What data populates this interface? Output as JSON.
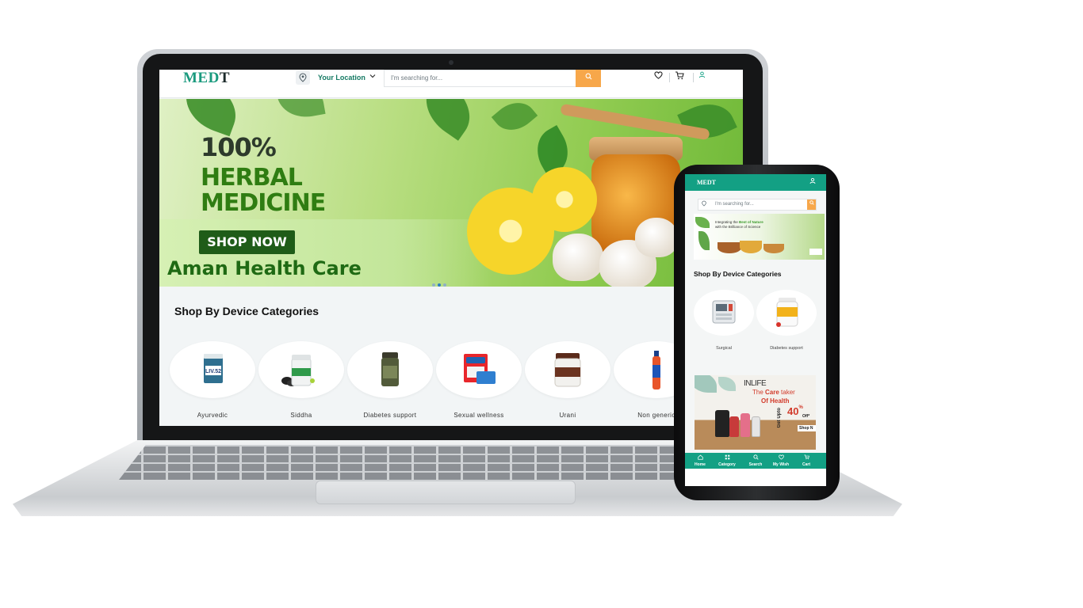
{
  "desktop": {
    "logo": {
      "main": "MED",
      "accent": "T"
    },
    "location": {
      "label": "Your Location",
      "pin_icon": "map-pin-icon",
      "chevron_icon": "chevron-down-icon"
    },
    "search": {
      "placeholder": "I'm searching for...",
      "button_icon": "search-icon"
    },
    "nav_icons": [
      "heart-icon",
      "cart-icon",
      "user-icon"
    ],
    "hero": {
      "line1": "100%",
      "line2": "HERBAL",
      "line3": "MEDICINE",
      "button": "SHOP NOW",
      "brand": "Aman Health Care",
      "slides": 3,
      "active_slide": 2
    },
    "categories_title": "Shop By Device Categories",
    "categories": [
      {
        "label": "Ayurvedic"
      },
      {
        "label": "Siddha"
      },
      {
        "label": "Diabetes support"
      },
      {
        "label": "Sexual wellness"
      },
      {
        "label": "Urani"
      },
      {
        "label": "Non generic"
      }
    ]
  },
  "mobile": {
    "logo": {
      "main": "MED",
      "accent": "T"
    },
    "search": {
      "placeholder": "I'm searching for..."
    },
    "banner": {
      "text_prefix": "Integrating the ",
      "text_highlight": "Best of Nature",
      "text_suffix": "with the Brilliance of Science"
    },
    "categories_title": "Shop By Device Categories",
    "categories": [
      {
        "label": "Surgical"
      },
      {
        "label": "Diabetes support"
      }
    ],
    "ad": {
      "brand": "INLIFE",
      "line1_prefix": "The ",
      "line1_highlight": "Care",
      "line1_suffix": " taker",
      "line2": "Of Health",
      "upto": "Get Upto",
      "percent": "40",
      "percent_sign": "%",
      "off": "Off*",
      "shop": "Shop N"
    },
    "tabs": [
      {
        "label": "Home",
        "icon": "home-icon"
      },
      {
        "label": "Category",
        "icon": "grid-icon"
      },
      {
        "label": "Search",
        "icon": "search-icon"
      },
      {
        "label": "My Wish",
        "icon": "heart-icon"
      },
      {
        "label": "Cart",
        "icon": "cart-icon"
      }
    ]
  },
  "colors": {
    "brand_teal": "#13a084",
    "search_orange": "#f7a74a",
    "hero_green": "#2f7d12",
    "hero_button": "#1f5c18"
  }
}
